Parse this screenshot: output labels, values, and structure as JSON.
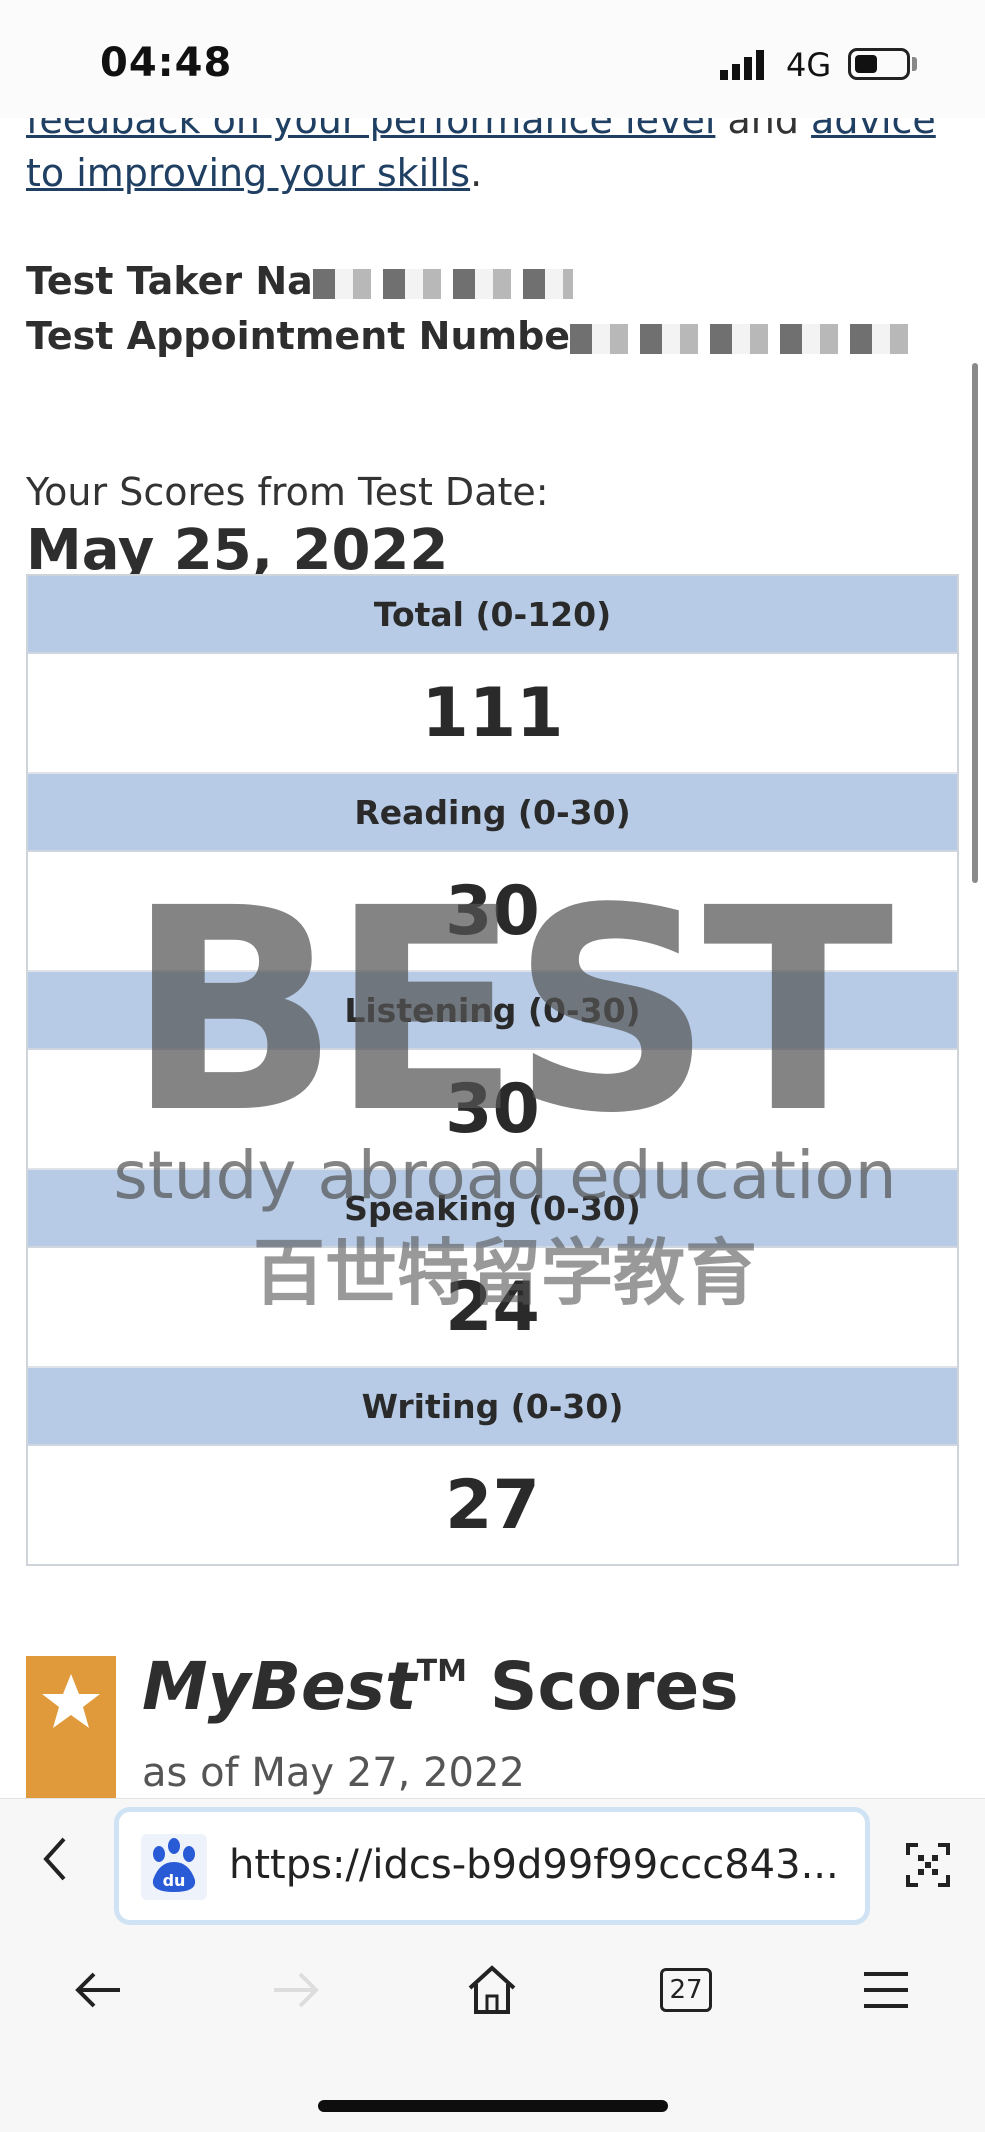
{
  "status_bar": {
    "time": "04:48",
    "network": "4G"
  },
  "intro": {
    "link1": "feedback on your performance level",
    "connector": " and ",
    "link2": "advice to improving your skills",
    "tail": "."
  },
  "test_taker": {
    "name_label": "Test Taker Na",
    "appointment_label": "Test Appointment Numbe"
  },
  "scores_header": {
    "label": "Your Scores from Test Date:",
    "date": "May 25, 2022"
  },
  "scores": [
    {
      "section": "Total (0-120)",
      "score": "111"
    },
    {
      "section": "Reading (0-30)",
      "score": "30"
    },
    {
      "section": "Listening (0-30)",
      "score": "30"
    },
    {
      "section": "Speaking (0-30)",
      "score": "24"
    },
    {
      "section": "Writing (0-30)",
      "score": "27"
    }
  ],
  "watermark": {
    "logo": "BEST",
    "line1": "study abroad education",
    "line2": "百世特留学教育"
  },
  "mybest": {
    "title_italic": "MyBest",
    "tm": "TM",
    "title_rest": " Scores",
    "date": "as of May 27, 2022"
  },
  "browser": {
    "url": "https://idcs-b9d99f99ccc843...",
    "tab_count": "27"
  },
  "colors": {
    "header_blue": "#b7cbe6",
    "badge_orange": "#e09a3c",
    "link": "#1f3f63"
  }
}
